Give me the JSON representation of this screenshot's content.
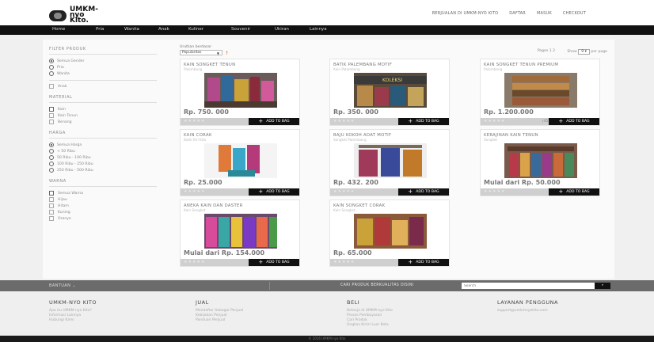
{
  "header": {
    "logo": "UMKM-nyo Kito.",
    "links": [
      "BERJUALAN DI UMKM-NYO KITO",
      "DAFTAR",
      "MASUK",
      "CHECKOUT"
    ]
  },
  "nav": [
    "Home",
    "Pria",
    "Wanita",
    "Anak",
    "Kuliner",
    "Souvenir",
    "Ukiran",
    "Lainnya"
  ],
  "sidebar": {
    "filter_title": "FILTER PRODUK",
    "gender": [
      "Semua Gender",
      "Pria",
      "Wanita"
    ],
    "anak": "Anak",
    "material_title": "MATERIAL",
    "materials": [
      "Kain",
      "Kain Tenun",
      "Benang"
    ],
    "harga_title": "HARGA",
    "harga": [
      "Semua Harga",
      "< 50 Ribu",
      "50 Ribu - 100 Ribu",
      "100 Ribu - 250 Ribu",
      "250 Ribu - 500 Ribu"
    ],
    "warna_title": "WARNA",
    "warna": [
      "Semua Warna",
      "Hijau",
      "Hitam",
      "Kuning",
      "Oranye"
    ]
  },
  "toolbar": {
    "sort_label": "Urutkan berdasar",
    "sort_value": "Popularitas",
    "pages": "Pages 1 2",
    "show_prefix": "Show",
    "per_page": "9",
    "per_page_suffix": "per page"
  },
  "products": [
    {
      "title": "KAIN SONGKET TENUN",
      "sub": "Palembang",
      "price": "Rp. 750. 000",
      "count": ""
    },
    {
      "title": "BATIK PALEMBANG MOTIF",
      "sub": "Kain Palembang",
      "price": "Rp. 350. 000",
      "count": ""
    },
    {
      "title": "KAIN SONGKET TENUN PREMIUM",
      "sub": "Palembang",
      "price": "Rp. 1.200.000",
      "count": "(45)"
    },
    {
      "title": "KAIN CORAK",
      "sub": "Batik Kiri Kito",
      "price": "Rp. 25.000",
      "count": ""
    },
    {
      "title": "BAJU KOKOH ADAT MOTIF",
      "sub": "Songket Palembang",
      "price": "Rp. 432. 200",
      "count": ""
    },
    {
      "title": "KERAJINAN KAIN TENUN",
      "sub": "Songket",
      "price": "Mulai dari Rp. 50.000",
      "count": ""
    },
    {
      "title": "ANEKA KAIN DAN DASTER",
      "sub": "Kain Songket",
      "price": "Mulai dari Rp. 154.000",
      "count": ""
    },
    {
      "title": "KAIN SONGKET CORAK",
      "sub": "Kain Songket",
      "price": "Rp. 65.000",
      "count": ""
    }
  ],
  "add_to_bag": "ADD TO BAG",
  "footbar": {
    "bantuan": "BANTUAN",
    "cari": "CARI PRODUK BERKUALITAS DISINI",
    "search_placeholder": "Search",
    "search_btn": "»"
  },
  "footer": {
    "col1": {
      "title": "UMKM-NYO KITO",
      "items": [
        "Apa itu UMKM-nyo Kito?",
        "Informasi Lainnya",
        "Hubungi Kami"
      ]
    },
    "col2": {
      "title": "JUAL",
      "items": [
        "Mendaftar Sebagai Penjual",
        "Kebijakan Penjual",
        "Panduan Penjual"
      ]
    },
    "col3": {
      "title": "BELI",
      "items": [
        "Belanja di UMKM-nyo Kito",
        "Proses Pembayaran",
        "Cari Produk",
        "Ongkos Kirim Luar Kota"
      ]
    },
    "col4": {
      "title": "LAYANAN PENGGUNA",
      "items": [
        "support@umkmnyokito.com"
      ]
    }
  },
  "copyright": "© 2016 UMKM-nyo Kito"
}
